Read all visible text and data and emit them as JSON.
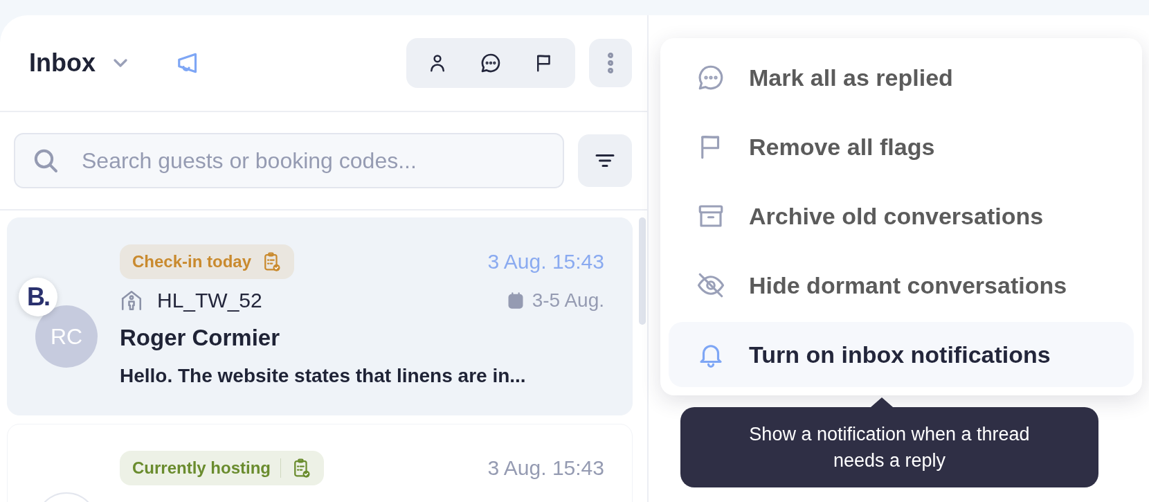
{
  "header": {
    "title": "Inbox"
  },
  "search": {
    "placeholder": "Search guests or booking codes..."
  },
  "conversations": [
    {
      "selected": true,
      "unread": true,
      "tag": {
        "label": "Check-in today",
        "color": "#c98a2e"
      },
      "time": "3 Aug. 15:43",
      "channel": "B.",
      "initials": "RC",
      "listing": "HL_TW_52",
      "dates": "3-5 Aug.",
      "guest": "Roger Cormier",
      "preview": "Hello. The website states that linens are in..."
    },
    {
      "selected": false,
      "unread": false,
      "tag": {
        "label": "Currently hosting",
        "color": "#6a8c2e"
      },
      "time": "3 Aug. 15:43"
    }
  ],
  "menu": {
    "items": [
      {
        "kind": "chat",
        "label": "Mark all as replied",
        "selected": false
      },
      {
        "kind": "flag",
        "label": "Remove all flags",
        "selected": false
      },
      {
        "kind": "archive",
        "label": "Archive old conversations",
        "selected": false
      },
      {
        "kind": "hide",
        "label": "Hide dormant conversations",
        "selected": false
      },
      {
        "kind": "bell",
        "label": "Turn on inbox notifications",
        "selected": true
      }
    ]
  },
  "tooltip": {
    "text": "Show a notification when a thread needs a reply"
  }
}
